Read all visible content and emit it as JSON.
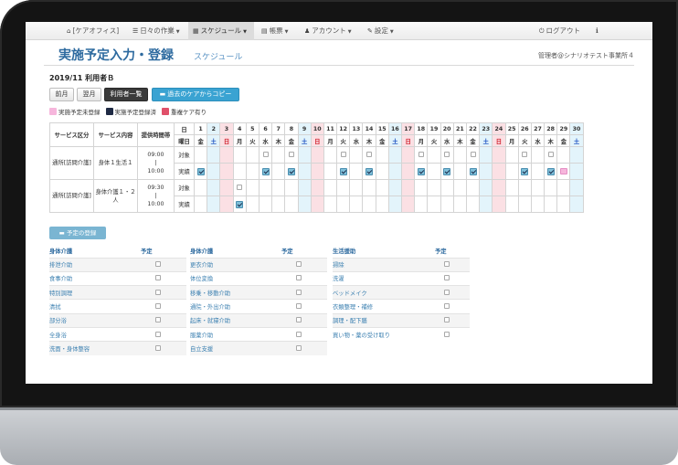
{
  "nav": {
    "items": [
      {
        "icon": "home-icon",
        "glyph": "⌂",
        "label": "[ケアオフィス]",
        "caret": false,
        "active": false
      },
      {
        "icon": "list-icon",
        "glyph": "☰",
        "label": "日々の作業",
        "caret": true,
        "active": false
      },
      {
        "icon": "calendar-icon",
        "glyph": "▦",
        "label": "スケジュール",
        "caret": true,
        "active": true
      },
      {
        "icon": "form-icon",
        "glyph": "▤",
        "label": "帳票",
        "caret": true,
        "active": false
      },
      {
        "icon": "user-icon",
        "glyph": "♟",
        "label": "アカウント",
        "caret": true,
        "active": false
      },
      {
        "icon": "wrench-icon",
        "glyph": "✎",
        "label": "設定",
        "caret": true,
        "active": false
      }
    ],
    "logout_label": "ログアウト",
    "logout_glyph": "⏻",
    "info_glyph": "ℹ"
  },
  "header": {
    "title": "実施予定入力・登録",
    "subtitle": "スケジュール",
    "office": "管理者@シナリオテスト事業所４"
  },
  "period_user": "2019/11 利用者Ｂ",
  "buttons": {
    "prev": "前月",
    "next": "翌月",
    "user_list": "利用者一覧",
    "copy": "過去のケアからコピー"
  },
  "legend": [
    {
      "label": "実施予定未登録",
      "color": "#f6b6dc"
    },
    {
      "label": "実施予定登録済",
      "color": "#7fbfd9"
    },
    {
      "label": "重複ケア有り",
      "color": "#e0506a"
    }
  ],
  "schedule": {
    "headers": {
      "service_type": "サービス区分",
      "service_content": "サービス内容",
      "time": "提供時間帯",
      "day_label": "日",
      "weekday_label": "曜日"
    },
    "days": [
      "1",
      "2",
      "3",
      "4",
      "5",
      "6",
      "7",
      "8",
      "9",
      "10",
      "11",
      "12",
      "13",
      "14",
      "15",
      "16",
      "17",
      "18",
      "19",
      "20",
      "21",
      "22",
      "23",
      "24",
      "25",
      "26",
      "27",
      "28",
      "29",
      "30"
    ],
    "weekdays": [
      "金",
      "土",
      "日",
      "月",
      "火",
      "水",
      "木",
      "金",
      "土",
      "日",
      "月",
      "火",
      "水",
      "木",
      "金",
      "土",
      "日",
      "月",
      "火",
      "水",
      "木",
      "金",
      "土",
      "日",
      "月",
      "火",
      "水",
      "木",
      "金",
      "土"
    ],
    "rows": [
      {
        "service_type": "通所[訪問介護]",
        "service_content": "身体１生活１",
        "time_start": "09:00",
        "time_sep": "|",
        "time_end": "10:00",
        "plan_label": "対象",
        "actual_label": "実績",
        "plan": [
          0,
          0,
          0,
          0,
          0,
          1,
          0,
          1,
          0,
          0,
          0,
          1,
          0,
          1,
          0,
          0,
          0,
          1,
          0,
          1,
          0,
          1,
          0,
          0,
          0,
          1,
          0,
          1,
          0,
          0
        ],
        "actual": [
          1,
          0,
          0,
          0,
          0,
          1,
          0,
          1,
          0,
          0,
          0,
          1,
          0,
          1,
          0,
          0,
          0,
          1,
          0,
          1,
          0,
          1,
          0,
          0,
          0,
          1,
          0,
          1,
          2,
          0
        ]
      },
      {
        "service_type": "通所[訪問介護]",
        "service_content": "身体介護１・２人",
        "time_start": "09:30",
        "time_sep": "|",
        "time_end": "10:00",
        "plan_label": "対象",
        "actual_label": "実績",
        "plan": [
          0,
          0,
          0,
          1,
          0,
          0,
          0,
          0,
          0,
          0,
          0,
          0,
          0,
          0,
          0,
          0,
          0,
          0,
          0,
          0,
          0,
          0,
          0,
          0,
          0,
          0,
          0,
          0,
          0,
          0
        ],
        "actual": [
          0,
          0,
          0,
          1,
          0,
          0,
          0,
          0,
          0,
          0,
          0,
          0,
          0,
          0,
          0,
          0,
          0,
          0,
          0,
          0,
          0,
          0,
          0,
          0,
          0,
          0,
          0,
          0,
          0,
          0
        ]
      }
    ]
  },
  "register_button": "予定の登録",
  "categories": [
    {
      "title": "身体介護",
      "col_label": "予定",
      "items": [
        "排泄介助",
        "食事介助",
        "特別調理",
        "清拭",
        "部分浴",
        "全身浴",
        "洗面・身体整容"
      ]
    },
    {
      "title": "身体介護",
      "col_label": "予定",
      "items": [
        "更衣介助",
        "体位変換",
        "移乗・移動介助",
        "通院・外出介助",
        "起床・就寝介助",
        "服薬介助",
        "自立支援"
      ]
    },
    {
      "title": "生活援助",
      "col_label": "予定",
      "items": [
        "掃除",
        "洗濯",
        "ベッドメイク",
        "衣類整理・補修",
        "調理・配下膳",
        "買い物・薬の受け取り"
      ]
    }
  ]
}
